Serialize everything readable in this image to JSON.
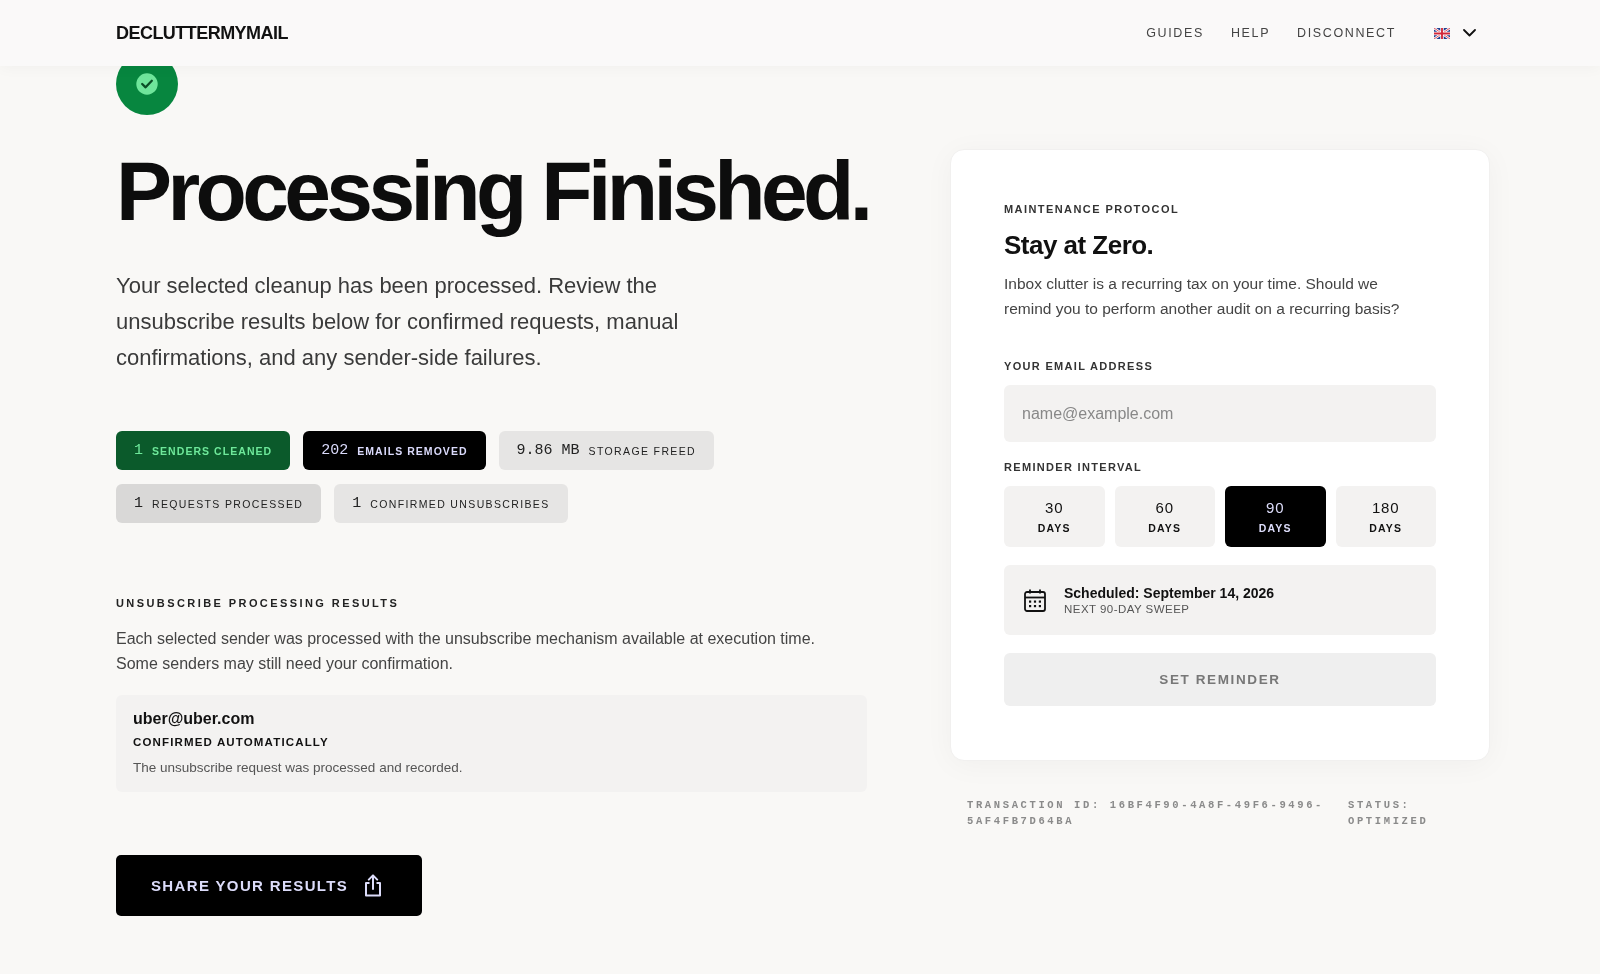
{
  "header": {
    "logo": "DECLUTTERMYMAIL",
    "nav": [
      "GUIDES",
      "HELP",
      "DISCONNECT"
    ]
  },
  "hero": {
    "title": "Processing Finished.",
    "description": "Your selected cleanup has been processed. Review the unsubscribe results below for confirmed requests, manual confirmations, and any sender-side failures."
  },
  "stats": [
    {
      "value": "1",
      "label": "SENDERS CLEANED",
      "kind": "success"
    },
    {
      "value": "202",
      "label": "EMAILS REMOVED",
      "kind": "dark"
    },
    {
      "value": "9.86 MB",
      "label": "STORAGE FREED",
      "kind": "light"
    },
    {
      "value": "1",
      "label": "REQUESTS PROCESSED",
      "kind": "muted"
    },
    {
      "value": "1",
      "label": "CONFIRMED UNSUBSCRIBES",
      "kind": "light"
    }
  ],
  "results": {
    "heading": "UNSUBSCRIBE PROCESSING RESULTS",
    "description": "Each selected sender was processed with the unsubscribe mechanism available at execution time. Some senders may still need your confirmation.",
    "items": [
      {
        "email": "uber@uber.com",
        "status": "CONFIRMED AUTOMATICALLY",
        "detail": "The unsubscribe request was processed and recorded."
      }
    ]
  },
  "share_button": "SHARE YOUR RESULTS",
  "reminder": {
    "eyebrow": "MAINTENANCE PROTOCOL",
    "title": "Stay at Zero.",
    "description": "Inbox clutter is a recurring tax on your time. Should we remind you to perform another audit on a recurring basis?",
    "email": {
      "label": "YOUR EMAIL ADDRESS",
      "placeholder": "name@example.com"
    },
    "interval_label": "REMINDER INTERVAL",
    "intervals": [
      {
        "value": "30",
        "unit": "DAYS",
        "selected": false
      },
      {
        "value": "60",
        "unit": "DAYS",
        "selected": false
      },
      {
        "value": "90",
        "unit": "DAYS",
        "selected": true
      },
      {
        "value": "180",
        "unit": "DAYS",
        "selected": false
      }
    ],
    "schedule": {
      "title": "Scheduled: September 14, 2026",
      "subtitle": "NEXT 90-DAY SWEEP"
    },
    "submit": {
      "label": "SET REMINDER",
      "disabled": true
    }
  },
  "footer": {
    "transaction": "TRANSACTION ID: 16BF4F90-4A8F-49F6-9496-5AF4FB7D64BA",
    "status": "STATUS: OPTIMIZED"
  }
}
